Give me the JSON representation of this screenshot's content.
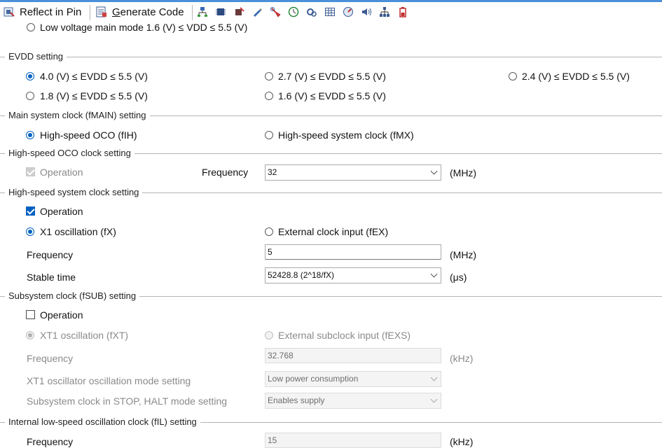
{
  "toolbar": {
    "reflect_label": "Reflect in Pin",
    "generate_label": "Generate Code",
    "icons": [
      "pin-map-icon",
      "chip-icon",
      "chip-config-icon",
      "pencil-icon",
      "wrench-icon",
      "clock-icon",
      "settings-gear-icon",
      "table-icon",
      "dial-icon",
      "speaker-icon",
      "network-icon",
      "battery-icon"
    ]
  },
  "operation_mode": {
    "low_voltage_label": "Low voltage main mode 1.6 (V) ≤ VDD ≤ 5.5 (V)"
  },
  "evdd": {
    "title": "EVDD setting",
    "opt1": "4.0 (V) ≤ EVDD ≤ 5.5 (V)",
    "opt2": "2.7 (V) ≤ EVDD ≤ 5.5 (V)",
    "opt3": "2.4 (V) ≤ EVDD ≤ 5.5 (V)",
    "opt4": "1.8 (V) ≤ EVDD ≤ 5.5 (V)",
    "opt5": "1.6 (V) ≤ EVDD ≤ 5.5 (V)",
    "selected": "4.0 (V) ≤ EVDD ≤ 5.5 (V)"
  },
  "main_clock": {
    "title": "Main system clock (fMAIN) setting",
    "opt1": "High-speed OCO (fIH)",
    "opt2": "High-speed system clock (fMX)",
    "selected": "High-speed OCO (fIH)"
  },
  "oco": {
    "title": "High-speed OCO clock setting",
    "operation_label": "Operation",
    "frequency_label": "Frequency",
    "frequency_value": "32",
    "unit": "(MHz)"
  },
  "hs_system": {
    "title": "High-speed system clock setting",
    "operation_label": "Operation",
    "opt1": "X1 oscillation (fX)",
    "opt2": "External clock input (fEX)",
    "frequency_label": "Frequency",
    "frequency_value": "5",
    "frequency_unit": "(MHz)",
    "stable_label": "Stable time",
    "stable_value": "52428.8 (2^18/fX)",
    "stable_unit": "(μs)"
  },
  "subsystem": {
    "title": "Subsystem clock (fSUB) setting",
    "operation_label": "Operation",
    "opt1": "XT1 oscillation (fXT)",
    "opt2": "External subclock input (fEXS)",
    "frequency_label": "Frequency",
    "frequency_value": "32.768",
    "frequency_unit": "(kHz)",
    "mode_label": "XT1 oscillator oscillation mode setting",
    "mode_value": "Low power consumption",
    "stop_label": "Subsystem clock in STOP, HALT mode setting",
    "stop_value": "Enables supply"
  },
  "low_speed": {
    "title": "Internal low-speed oscillation clock (fIL) setting",
    "frequency_label": "Frequency",
    "frequency_value": "15",
    "frequency_unit": "(kHz)"
  }
}
